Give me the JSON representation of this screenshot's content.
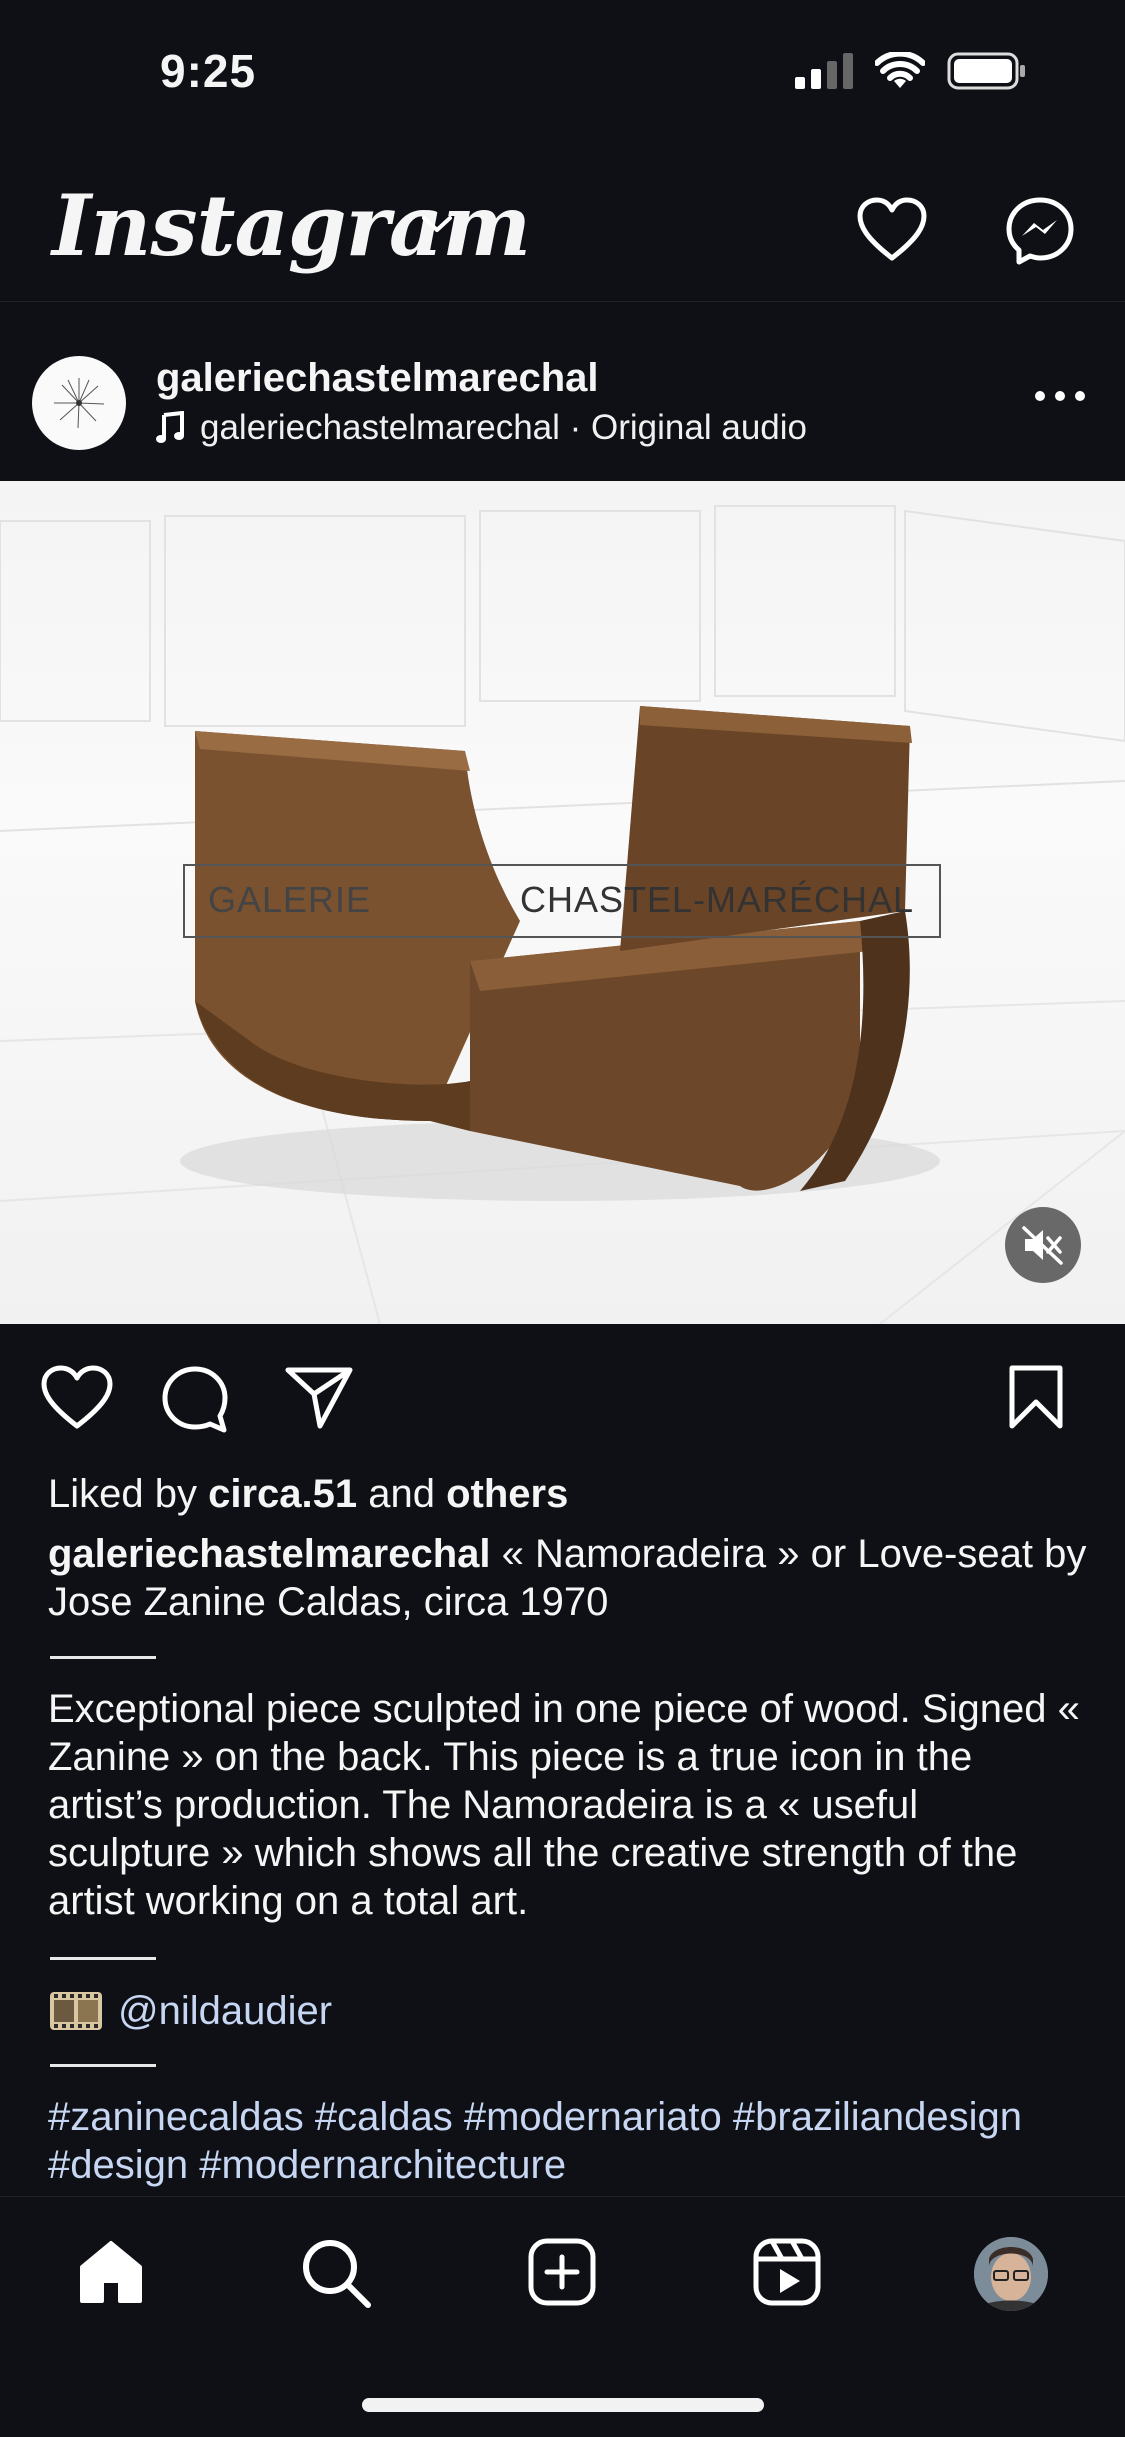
{
  "status_bar": {
    "time": "9:25"
  },
  "header": {
    "logo_text": "Instagram"
  },
  "post": {
    "username": "galeriechastelmarechal",
    "audio_user": "galeriechastelmarechal",
    "audio_sep": " · ",
    "audio_label": "Original audio",
    "media": {
      "watermark_left": "GALERIE",
      "watermark_right": "CHASTEL-MARÉCHAL",
      "muted": true
    },
    "likes": {
      "prefix": "Liked by ",
      "user": "circa.51",
      "middle": " and ",
      "others": "others"
    },
    "caption_user": "galeriechastelmarechal",
    "caption_text": " « Namoradeira » or Love-seat by Jose Zanine Caldas, circa 1970",
    "description": "Exceptional piece sculpted in one piece of wood. Signed « Zanine » on the back. This piece is a true icon in the artist’s production. The Namoradeira is a « useful sculpture » which shows all the creative strength of the artist working on a total art.",
    "credit_handle": "@nildaudier",
    "hashtags": "#zaninecaldas #caldas #modernariato #braziliandesign #design #modernarchitecture"
  },
  "nav": {
    "items": [
      "home-icon",
      "search-icon",
      "create-icon",
      "reels-icon",
      "profile-avatar"
    ]
  },
  "colors": {
    "background": "#0e1015",
    "link": "#c7d6f2"
  }
}
